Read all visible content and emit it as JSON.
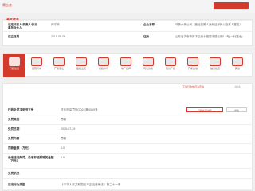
{
  "header": {
    "brand": "鹰企查"
  },
  "info": {
    "tag": "基本信息",
    "row1": {
      "k1": "法定代表人/负责人/执行事务合伙人",
      "v1": "乔宇婷",
      "k2": "企业名称",
      "v2": "乌鲁木齐公司（营业执照人身份证号码以及本人签名）"
    },
    "row2": {
      "k1": "成立日期",
      "v1": "2015-05-28",
      "k2": "住所",
      "v2": "山东省济南市历下区经十路丽泽楼北侧1-6号(一行路北)"
    }
  },
  "tabs": [
    {
      "label": "行政处罚"
    },
    {
      "label": "经营异常"
    },
    {
      "label": "严重违法"
    },
    {
      "label": "股权出质"
    },
    {
      "label": "行政许可"
    },
    {
      "label": "动产抵押"
    },
    {
      "label": "司法协助"
    },
    {
      "label": "知识产权"
    },
    {
      "label": "严重失信"
    },
    {
      "label": "抽查检查"
    },
    {
      "label": "其他"
    }
  ],
  "detail": {
    "header_red": "下载行政处罚决定书",
    "header_gray": "共1条",
    "rows": [
      {
        "k": "行政处罚决定书文号",
        "v": "济乐市监罚处[2024]第0019号"
      },
      {
        "k": "处罚类别",
        "v": "罚款"
      },
      {
        "k": "处罚日期",
        "v": "2025-07-29"
      },
      {
        "k": "处罚内容",
        "v": "罚款"
      },
      {
        "k": "罚款金额（万元）",
        "v": "3.0"
      },
      {
        "k": "没收违法所得、没收非法财物的金额（万元）",
        "v": "0.0"
      },
      {
        "k": "处罚机关",
        "v": ""
      },
      {
        "k": "违法行为类型",
        "v": "《中华人民共和国反不正当竞争法》第二十一条"
      }
    ],
    "badge_red": "行政处罚详情",
    "badge_gray": "详情"
  },
  "colors": {
    "accent": "#d23a2c"
  }
}
